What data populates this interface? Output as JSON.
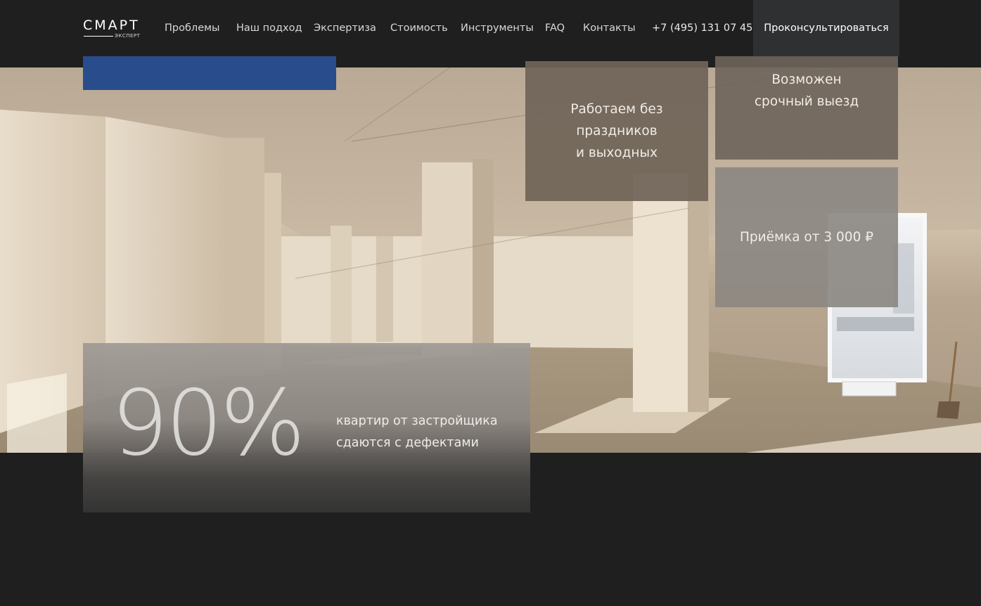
{
  "header": {
    "logo": {
      "main": "СМАРТ",
      "sub": "ЭКСПЕРТ"
    },
    "nav": [
      "Проблемы",
      "Наш подход",
      "Экспертиза",
      "Стоимость",
      "Инструменты",
      "FAQ",
      "Контакты"
    ],
    "phone": "+7 (495) 131 07 45",
    "cta_label": "Проконсультироваться"
  },
  "hero": {
    "cards": [
      "Работаем без\nпраздников\nи выходных",
      "Возможен\nсрочный выезд",
      "Приёмка от 3 000 ₽"
    ],
    "stat": {
      "value": "90%",
      "caption": "квартир от застройщика\nсдаются с дефектами"
    }
  },
  "colors": {
    "background": "#1f1f1f",
    "accent_blue": "#294c8c",
    "button_bg": "#2f3032"
  }
}
